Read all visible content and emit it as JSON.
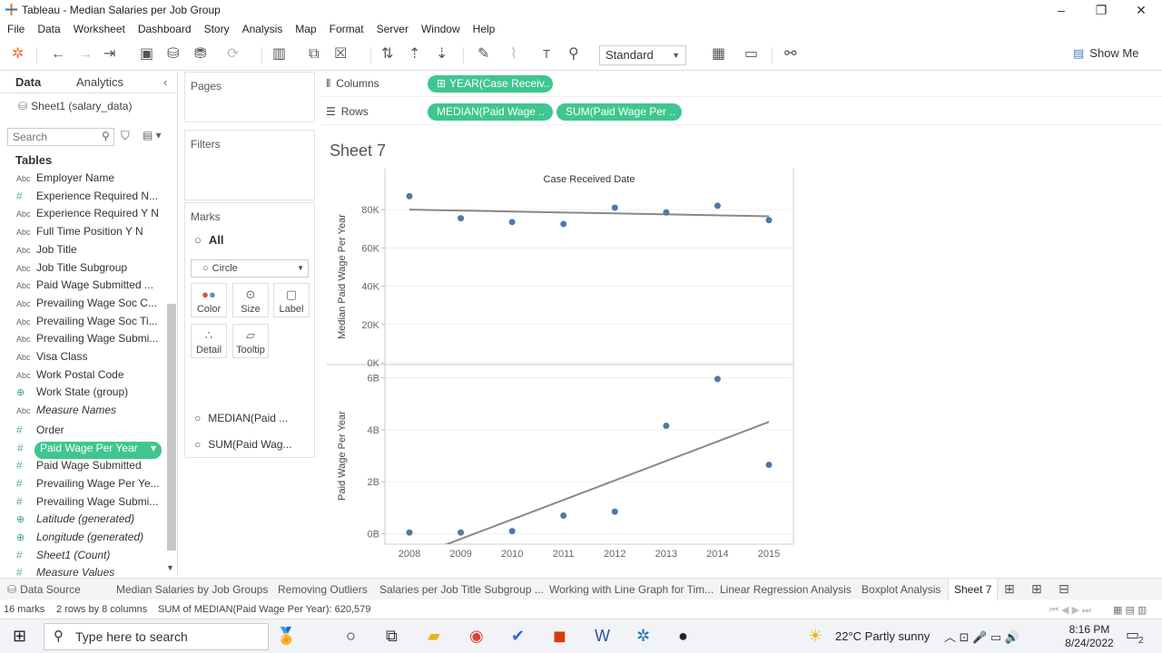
{
  "window": {
    "title": "Tableau - Median Salaries per Job Group"
  },
  "menu": [
    "File",
    "Data",
    "Worksheet",
    "Dashboard",
    "Story",
    "Analysis",
    "Map",
    "Format",
    "Server",
    "Window",
    "Help"
  ],
  "toolbar": {
    "fit_select": "Standard",
    "show_me": "Show Me"
  },
  "data_pane": {
    "tabs": [
      "Data",
      "Analytics"
    ],
    "datasource": "Sheet1 (salary_data)",
    "search_placeholder": "Search",
    "tables_heading": "Tables",
    "fields": [
      {
        "icon": "Abc",
        "label": "Employer Name"
      },
      {
        "icon": "#",
        "label": "Experience Required N..."
      },
      {
        "icon": "Abc",
        "label": "Experience Required Y N"
      },
      {
        "icon": "Abc",
        "label": "Full Time Position Y N"
      },
      {
        "icon": "Abc",
        "label": "Job Title"
      },
      {
        "icon": "Abc",
        "label": "Job Title Subgroup"
      },
      {
        "icon": "Abc",
        "label": "Paid Wage Submitted ..."
      },
      {
        "icon": "Abc",
        "label": "Prevailing Wage Soc C..."
      },
      {
        "icon": "Abc",
        "label": "Prevailing Wage Soc Ti..."
      },
      {
        "icon": "Abc",
        "label": "Prevailing Wage Submi..."
      },
      {
        "icon": "Abc",
        "label": "Visa Class"
      },
      {
        "icon": "Abc",
        "label": "Work Postal Code"
      },
      {
        "icon": "globe",
        "label": "Work State (group)"
      },
      {
        "icon": "Abc",
        "label": "Measure Names",
        "italic": true
      },
      {
        "icon": "#",
        "label": "Order"
      },
      {
        "icon": "#",
        "label": "Paid Wage Per Year",
        "selected": true
      },
      {
        "icon": "#",
        "label": "Paid Wage Submitted"
      },
      {
        "icon": "#",
        "label": "Prevailing Wage Per Ye..."
      },
      {
        "icon": "#",
        "label": "Prevailing Wage Submi..."
      },
      {
        "icon": "globe",
        "label": "Latitude (generated)",
        "italic": true
      },
      {
        "icon": "globe",
        "label": "Longitude (generated)",
        "italic": true
      },
      {
        "icon": "#",
        "label": "Sheet1 (Count)",
        "italic": true
      },
      {
        "icon": "#",
        "label": "Measure Values",
        "italic": true
      }
    ]
  },
  "shelves": {
    "pages_label": "Pages",
    "filters_label": "Filters",
    "marks_label": "Marks",
    "marks_all": "All",
    "mark_type": "Circle",
    "mark_buttons": [
      "Color",
      "Size",
      "Label",
      "Detail",
      "Tooltip"
    ],
    "mark_cards": [
      "MEDIAN(Paid ...",
      "SUM(Paid Wag..."
    ],
    "columns_label": "Columns",
    "rows_label": "Rows",
    "columns_pills": [
      "YEAR(Case Receiv.."
    ],
    "rows_pills": [
      "MEDIAN(Paid Wage ..",
      "SUM(Paid Wage Per .."
    ]
  },
  "sheet": {
    "title": "Sheet 7"
  },
  "chart_data": [
    {
      "type": "scatter",
      "title": "Case Received Date",
      "ylabel": "Median Paid Wage Per Year",
      "x": [
        2008,
        2009,
        2010,
        2011,
        2012,
        2013,
        2014,
        2015
      ],
      "values": [
        87000,
        75500,
        73500,
        72500,
        81000,
        78500,
        82000,
        74500
      ],
      "yticks": [
        "80K",
        "60K",
        "40K",
        "20K",
        "0K"
      ],
      "ylim": [
        0,
        90000
      ],
      "trend_line": [
        80000,
        76500
      ]
    },
    {
      "type": "scatter",
      "ylabel": "Paid Wage Per Year",
      "x": [
        2008,
        2009,
        2010,
        2011,
        2012,
        2013,
        2014,
        2015
      ],
      "values": [
        0.05,
        0.05,
        0.1,
        0.7,
        0.85,
        4.15,
        5.95,
        2.65
      ],
      "yticks": [
        "6B",
        "4B",
        "2B",
        "0B"
      ],
      "ylim": [
        -0.4,
        6.4
      ],
      "trend_line": [
        -0.95,
        4.3
      ],
      "xticks": [
        "2008",
        "2009",
        "2010",
        "2011",
        "2012",
        "2013",
        "2014",
        "2015"
      ]
    }
  ],
  "sheet_tabs": [
    "Data Source",
    "Median Salaries by Job Groups",
    "Removing Outliers",
    "Salaries per Job Title Subgroup ...",
    "Working with Line Graph for Tim...",
    "Linear Regression Analysis",
    "Boxplot Analysis",
    "Sheet 7"
  ],
  "status": {
    "marks": "16 marks",
    "dims": "2 rows by 8 columns",
    "sum": "SUM of MEDIAN(Paid Wage Per Year): 620,579"
  },
  "taskbar": {
    "search_placeholder": "Type here to search",
    "weather": "22°C  Partly sunny",
    "time": "8:16 PM",
    "date": "8/24/2022",
    "notification_count": "2"
  }
}
